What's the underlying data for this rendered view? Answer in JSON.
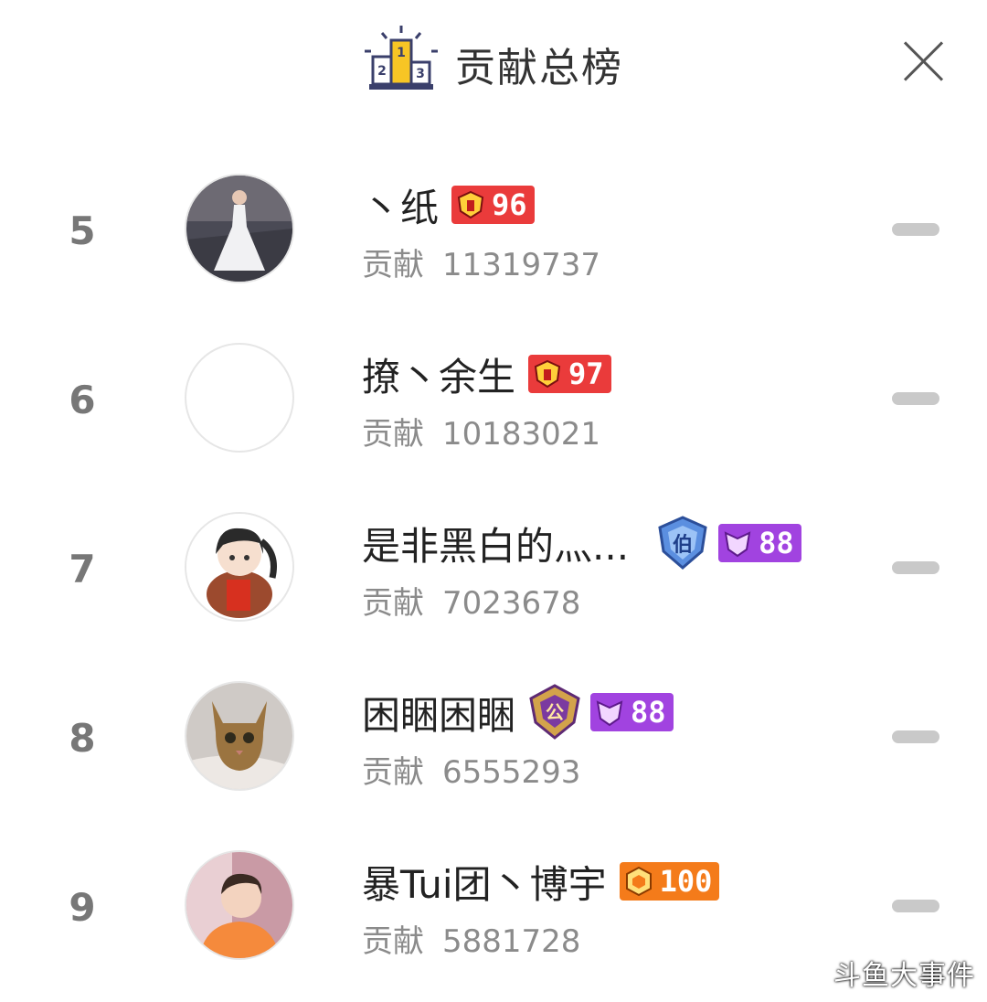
{
  "header": {
    "title": "贡献总榜",
    "podium_icon": "podium-icon",
    "podium_numbers": [
      "2",
      "1",
      "3"
    ],
    "close_icon": "close-icon"
  },
  "contribution_label": "贡献",
  "rows": [
    {
      "rank": "5",
      "name": "丶纸",
      "level": "96",
      "level_style": "red",
      "contribution": "11319737",
      "avatar": "avatar-woman-white-dress",
      "trend_icon": "flat-dash-icon"
    },
    {
      "rank": "6",
      "name": "撩丶余生",
      "level": "97",
      "level_style": "red",
      "contribution": "10183021",
      "avatar": "avatar-empty",
      "trend_icon": "flat-dash-icon"
    },
    {
      "rank": "7",
      "name": "是非黑白的灬...",
      "noble_badge": "伯",
      "level": "88",
      "level_style": "purple",
      "contribution": "7023678",
      "avatar": "avatar-cartoon-girl",
      "trend_icon": "flat-dash-icon"
    },
    {
      "rank": "8",
      "name": "困睏困睏",
      "noble_badge": "公",
      "level": "88",
      "level_style": "purple",
      "contribution": "6555293",
      "avatar": "avatar-cat",
      "trend_icon": "flat-dash-icon"
    },
    {
      "rank": "9",
      "name": "暴Tui团丶博宇",
      "level": "100",
      "level_style": "orange",
      "contribution": "5881728",
      "avatar": "avatar-man-orange",
      "trend_icon": "flat-dash-icon"
    }
  ],
  "watermark": "斗鱼大事件",
  "colors": {
    "level_red": "#ea3b3b",
    "level_purple": "#a143e0",
    "level_orange": "#f47b1a",
    "rank_text": "#777777"
  }
}
